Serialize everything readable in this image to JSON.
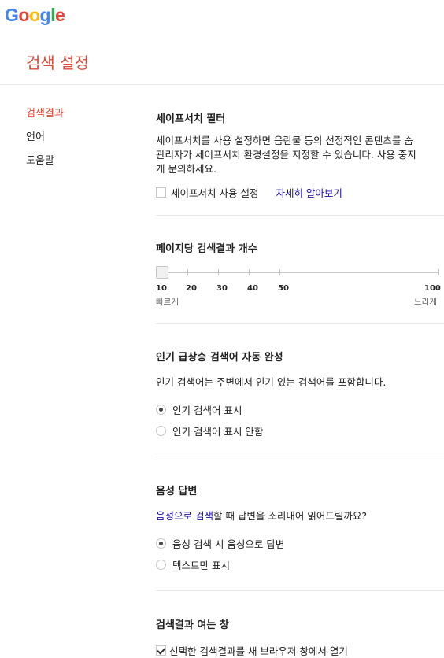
{
  "logo": {
    "letters": [
      "G",
      "o",
      "o",
      "g",
      "l",
      "e"
    ],
    "colors": [
      "#4285f4",
      "#ea4335",
      "#fbbc05",
      "#4285f4",
      "#34a853",
      "#ea4335"
    ]
  },
  "page_title": "검색 설정",
  "nav": {
    "items": [
      {
        "label": "검색결과",
        "active": true
      },
      {
        "label": "언어"
      },
      {
        "label": "도움말"
      }
    ]
  },
  "safesearch": {
    "title": "세이프서치 필터",
    "desc_line1": "세이프서치를 사용 설정하면 음란물 등의 선정적인 콘텐츠를 숨",
    "desc_line2": "관리자가 세이프서치 환경설정을 지정할 수 있습니다. 사용 중지",
    "desc_line3": "게 문의하세요.",
    "checkbox_label": "세이프서치 사용 설정",
    "learn_more": "자세히 알아보기"
  },
  "results_per_page": {
    "title": "페이지당 검색결과 개수",
    "ticks": [
      "10",
      "20",
      "30",
      "40",
      "50",
      "100"
    ],
    "selected": "10",
    "fast_label": "빠르게",
    "slow_label": "느리게"
  },
  "trending": {
    "title": "인기 급상승 검색어 자동 완성",
    "desc": "인기 검색어는 주변에서 인기 있는 검색어를 포함합니다.",
    "options": [
      "인기 검색어 표시",
      "인기 검색어 표시 안함"
    ],
    "selected_index": 0
  },
  "voice": {
    "title": "음성 답변",
    "desc_link": "음성으로 검색",
    "desc_rest": "할 때 답변을 소리내어 읽어드릴까요?",
    "options": [
      "음성 검색 시 음성으로 답변",
      "텍스트만 표시"
    ],
    "selected_index": 0
  },
  "results_window": {
    "title": "검색결과 여는 창",
    "checkbox_label": "선택한 검색결과를 새 브라우저 창에서 열기",
    "checked": true
  }
}
